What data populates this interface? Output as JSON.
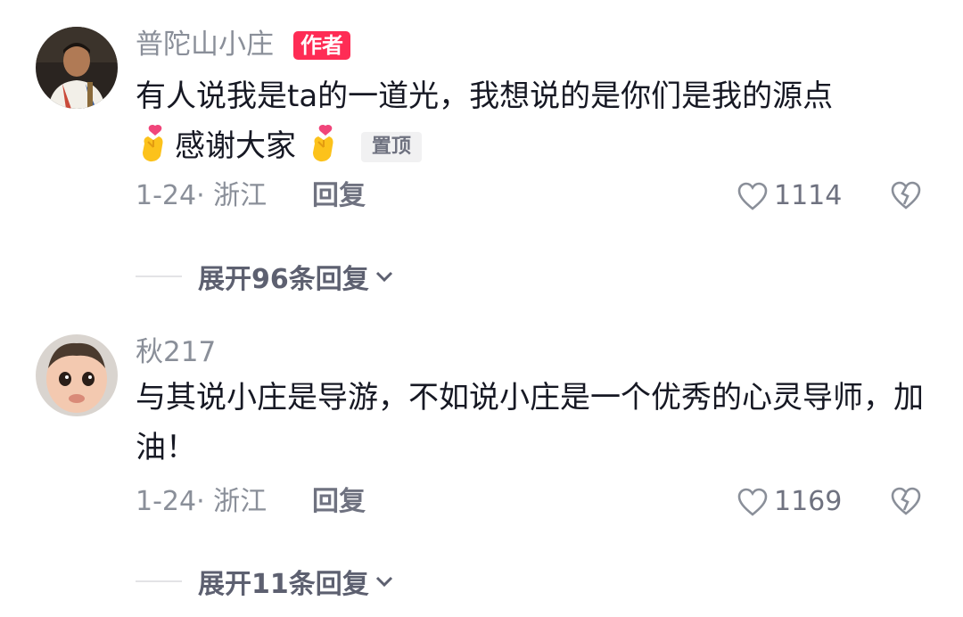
{
  "comments": [
    {
      "username": "普陀山小庄",
      "author_badge": "作者",
      "text_part1": "有人说我是ta的一道光，我想说的是你们是我的源点",
      "text_part2": "感谢大家",
      "emoji": "heart-hands-emoji",
      "pinned_label": "置顶",
      "date_location": "1-24· 浙江",
      "reply_label": "回复",
      "likes": "1114",
      "expand_label": "展开96条回复"
    },
    {
      "username": "秋217",
      "text": "与其说小庄是导游，不如说小庄是一个优秀的心灵导师，加油！",
      "date_location": "1-24· 浙江",
      "reply_label": "回复",
      "likes": "1169",
      "expand_label": "展开11条回复"
    }
  ],
  "icons": {
    "like": "heart-outline-icon",
    "dislike": "broken-heart-icon",
    "expand": "chevron-down-icon"
  },
  "colors": {
    "author_badge": "#fe2c55",
    "meta_text": "#8a8f99",
    "body_text": "#161823"
  }
}
